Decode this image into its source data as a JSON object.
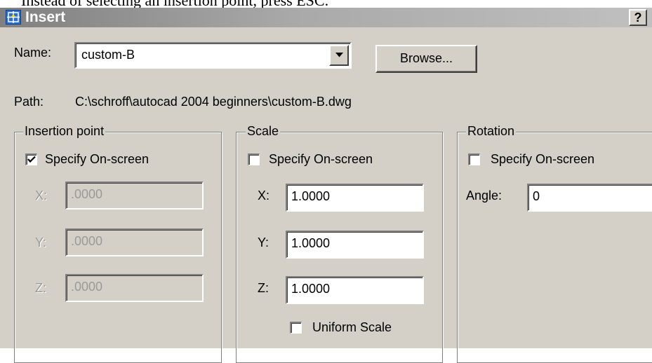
{
  "document": {
    "partial_line": "Instead of selecting an insertion point, press ESC."
  },
  "dialog": {
    "title": "Insert",
    "help_label": "?",
    "name_label": "Name:",
    "name_value": "custom-B",
    "browse_label": "Browse...",
    "path_label": "Path:",
    "path_value": "C:\\schroff\\autocad 2004 beginners\\custom-B.dwg"
  },
  "insertion_point": {
    "legend": "Insertion point",
    "specify_label": "Specify On-screen",
    "specify_checked": true,
    "x_label": "X:",
    "x_value": ".0000",
    "y_label": "Y:",
    "y_value": ".0000",
    "z_label": "Z:",
    "z_value": ".0000"
  },
  "scale": {
    "legend": "Scale",
    "specify_label": "Specify On-screen",
    "specify_checked": false,
    "x_label": "X:",
    "x_value": "1.0000",
    "y_label": "Y:",
    "y_value": "1.0000",
    "z_label": "Z:",
    "z_value": "1.0000",
    "uniform_label": "Uniform Scale",
    "uniform_checked": false
  },
  "rotation": {
    "legend": "Rotation",
    "specify_label": "Specify On-screen",
    "specify_checked": false,
    "angle_label": "Angle:",
    "angle_value": "0"
  },
  "colors": {
    "dialog_face": "#d4d0c8",
    "titlebar_inactive": "#a9a9a9",
    "disabled_text": "#9a9a9a"
  },
  "icons": {
    "title": "insert-block-icon",
    "dropdown": "chevron-down-icon",
    "check": "checkmark-icon"
  }
}
